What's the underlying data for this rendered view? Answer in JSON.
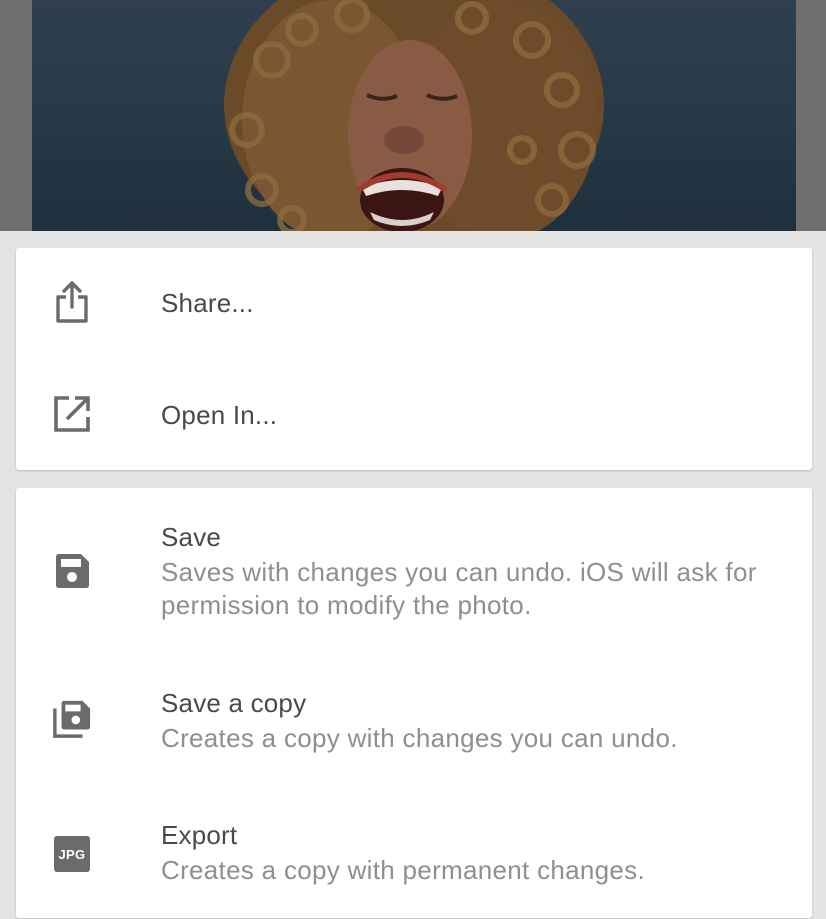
{
  "photo": {
    "icon": "portrait-photo"
  },
  "menu_top": {
    "items": [
      {
        "label": "Share...",
        "icon": "share-icon"
      },
      {
        "label": "Open In...",
        "icon": "open-in-icon"
      }
    ]
  },
  "menu_bottom": {
    "items": [
      {
        "label": "Save",
        "description": "Saves with changes you can undo. iOS will ask for permission to modify the photo.",
        "icon": "save-icon"
      },
      {
        "label": "Save a copy",
        "description": "Creates a copy with changes you can undo.",
        "icon": "save-copy-icon"
      },
      {
        "label": "Export",
        "description": "Creates a copy with permanent changes.",
        "icon": "jpg-icon",
        "badge": "JPG"
      }
    ]
  },
  "colors": {
    "backdrop": "#e4e4e4",
    "card": "#ffffff",
    "title_text": "#4a4a4a",
    "description_text": "#8f8f8f",
    "icon": "#6b6b6b"
  }
}
